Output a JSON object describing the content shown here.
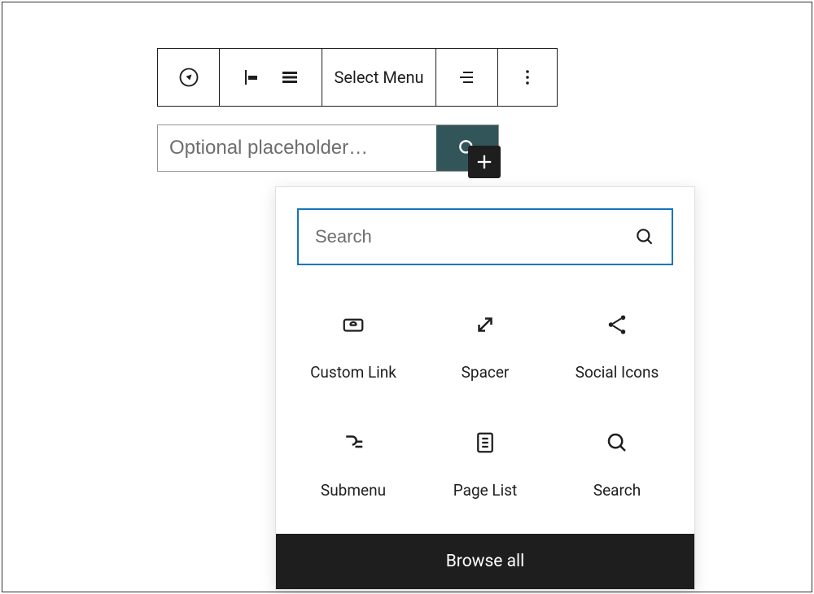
{
  "toolbar": {
    "select_menu_label": "Select Menu"
  },
  "searchbar": {
    "placeholder": "Optional placeholder…",
    "value": ""
  },
  "inserter": {
    "search_placeholder": "Search",
    "search_value": "",
    "blocks": [
      {
        "label": "Custom Link"
      },
      {
        "label": "Spacer"
      },
      {
        "label": "Social Icons"
      },
      {
        "label": "Submenu"
      },
      {
        "label": "Page List"
      },
      {
        "label": "Search"
      }
    ],
    "browse_all_label": "Browse all"
  }
}
